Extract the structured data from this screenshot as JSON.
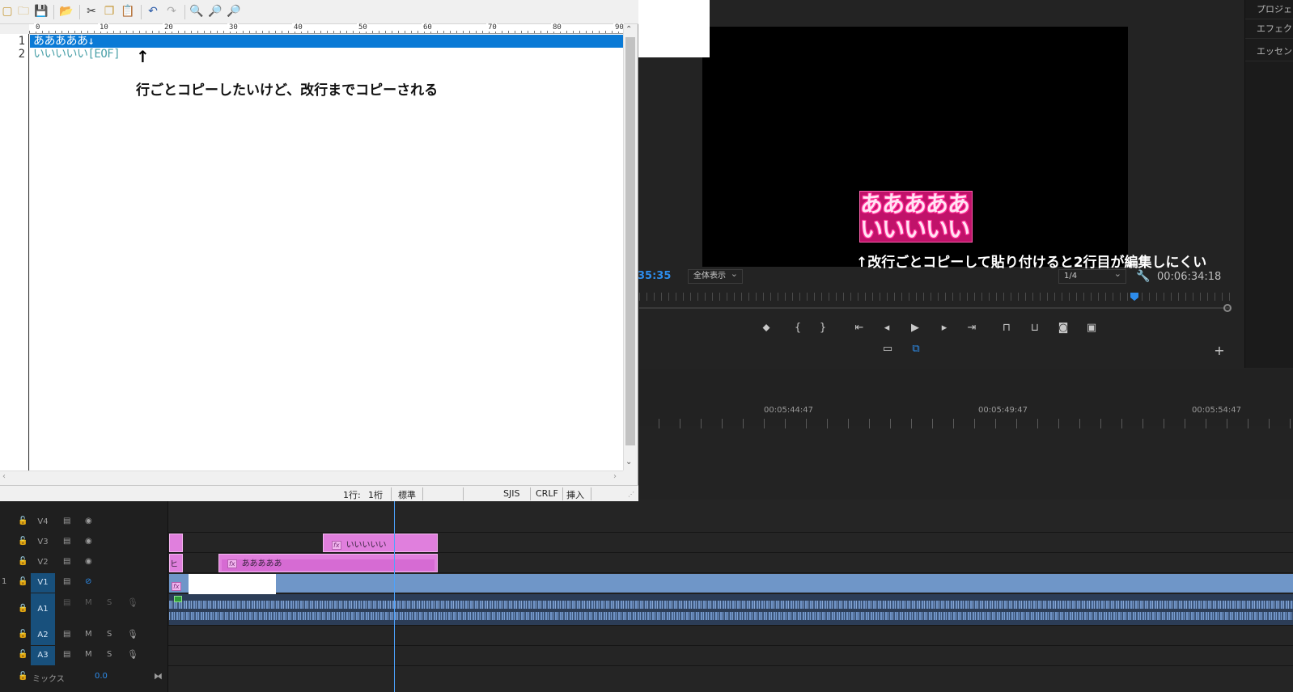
{
  "editor": {
    "toolbar_icons": [
      "new-file-icon",
      "open-folder-icon",
      "save-icon",
      "open-recent-icon",
      "cut-icon",
      "copy-icon",
      "paste-icon",
      "undo-icon",
      "redo-icon",
      "search-icon",
      "search-next-icon",
      "search-prev-icon"
    ],
    "ruler_numbers": [
      "0",
      "10",
      "20",
      "30",
      "40",
      "50",
      "60",
      "70",
      "80",
      "90"
    ],
    "line_numbers": [
      "1",
      "2"
    ],
    "lines": [
      "あああああ↓",
      "いいいいい[EOF]"
    ],
    "arrow_up": "↑",
    "annotation": "行ごとコピーしたいけど、改行までコピーされる",
    "status": {
      "position_row": "1行:",
      "position_col": "1桁",
      "mode": "標準",
      "encoding": "SJIS",
      "line_ending": "CRLF",
      "insert_mode": "挿入"
    },
    "colors": {
      "selection": "#0a7ad6"
    }
  },
  "premiere": {
    "right_panel_tabs": [
      "プロジェク",
      "エフェクト",
      "エッセンシ"
    ],
    "monitor": {
      "title_lines": [
        "あああああ",
        "いいいいい"
      ],
      "annotation": "↑改行ごとコピーして貼り付けると2行目が編集しにくい",
      "timecode_left": "35:35",
      "fit_dropdown": "全体表示",
      "resolution_dropdown": "1/4",
      "timecode_right": "00:06:34:18",
      "controls": [
        "marker-icon",
        "in-point-icon",
        "out-point-icon",
        "go-to-in-icon",
        "step-back-icon",
        "play-icon",
        "step-forward-icon",
        "go-to-out-icon",
        "insert-icon",
        "overwrite-icon",
        "export-frame-icon",
        "compare-icon"
      ],
      "add_button": "+"
    },
    "timeline": {
      "ruler_times": [
        "00:05:44:47",
        "00:05:49:47",
        "00:05:54:47"
      ],
      "tracks": [
        {
          "name": "V4",
          "kind": "video"
        },
        {
          "name": "V3",
          "kind": "video"
        },
        {
          "name": "V2",
          "kind": "video"
        },
        {
          "name": "V1",
          "kind": "video",
          "active": true
        },
        {
          "name": "A1",
          "kind": "audio",
          "active": true
        },
        {
          "name": "A2",
          "kind": "audio"
        },
        {
          "name": "A3",
          "kind": "audio"
        }
      ],
      "track_m": "M",
      "track_s": "S",
      "v1_side_label": "1",
      "v3_clip_label": "いいいいい",
      "v2_clip_label": "あああああ",
      "v2_left_clip_label": "ヒ",
      "fx_label": "fx",
      "mix_label": "ミックス",
      "mix_value": "0.0",
      "colors": {
        "clip_pink": "#e07fdd",
        "clip_blue": "#6f96c8",
        "audio": "#3b5478",
        "playhead": "#4ca3ff"
      }
    }
  }
}
